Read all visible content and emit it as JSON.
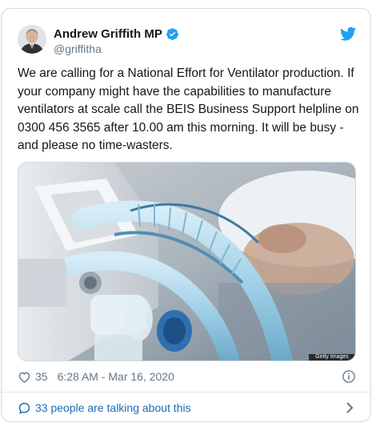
{
  "tweet": {
    "author": {
      "display_name": "Andrew Griffith MP",
      "handle": "@griffitha",
      "verified": true
    },
    "text": "We are calling for a National Effort for Ventilator production. If your company might have the capabilities to manufacture ventilators at scale call the BEIS Business Support helpline on 0300 456 3565 after 10.00 am this morning. It will be busy - and please no time-wasters.",
    "media": {
      "credit": "Getty Images"
    },
    "likes": "35",
    "timestamp": "6:28 AM - Mar 16, 2020",
    "conversation_label": "33 people are talking about this"
  },
  "icons": {
    "verified": "verified-badge-icon",
    "twitter": "twitter-bird-icon",
    "like": "heart-icon",
    "info": "info-icon",
    "conversation": "speech-bubble-icon",
    "chevron": "chevron-right-icon"
  },
  "colors": {
    "brand_blue": "#1da1f2",
    "link_blue": "#1b6bb3",
    "muted": "#657786",
    "text": "#14171a",
    "border": "#cfd9de"
  }
}
